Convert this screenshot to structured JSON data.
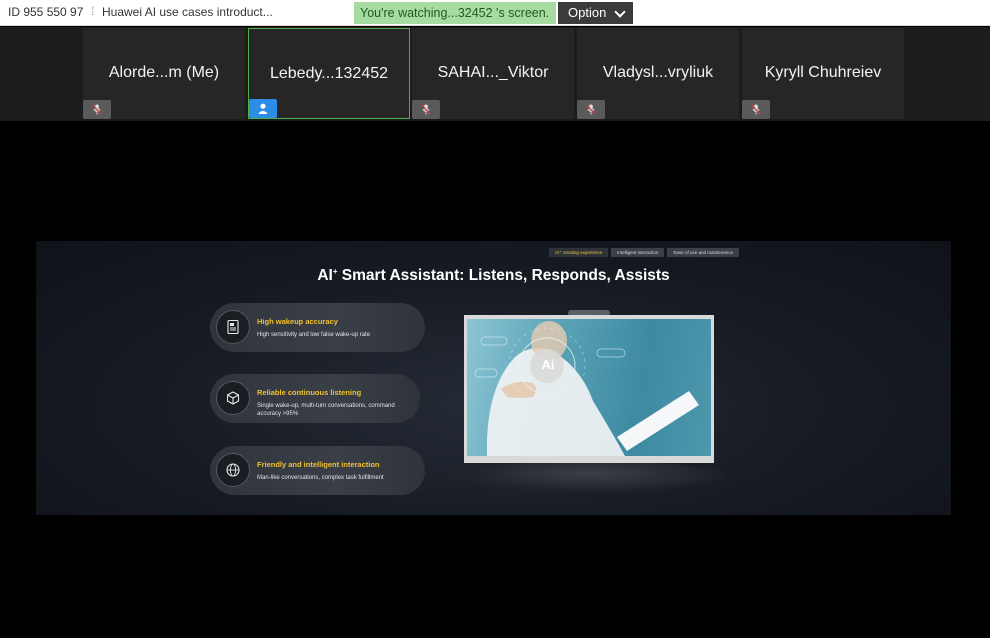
{
  "topbar": {
    "meeting_id": "ID 955 550 97",
    "separator": "⁞",
    "meeting_title": "Huawei AI use cases introduct...",
    "watch_banner": "You're watching...32452 's screen.",
    "option_label": "Option"
  },
  "participants": [
    {
      "name": "Alorde...m (Me)",
      "icon": "mic-muted-icon"
    },
    {
      "name": "Lebedy...132452",
      "icon": "user-icon"
    },
    {
      "name": "SAHAI..._Viktor",
      "icon": "mic-muted-icon"
    },
    {
      "name": "Vladysl...vryliuk",
      "icon": "mic-muted-icon"
    },
    {
      "name": "Kyryll Chuhreiev",
      "icon": "mic-muted-icon"
    }
  ],
  "slide": {
    "tabs": [
      "AI⁺ creating experience",
      "Intelligent interaction",
      "Ease of use and maintenance"
    ],
    "title_prefix": "AI",
    "title_sup": "+",
    "title_rest": " Smart Assistant: Listens, Responds, Assists",
    "features": [
      {
        "icon": "tablet-icon",
        "head": "High wakeup accuracy",
        "desc": "High sensitivity and low false wake-up rate"
      },
      {
        "icon": "cube-icon",
        "head": "Reliable continuous listening",
        "desc": "Single wake-up, multi-turn conversations, command accuracy >95%"
      },
      {
        "icon": "globe-icon",
        "head": "Friendly and intelligent interaction",
        "desc": "Man-like conversations, complex task fulfillment"
      }
    ],
    "screen_badge": "Ai"
  },
  "colors": {
    "active_tile_border": "#4caf50",
    "banner_bg": "#a6dca2",
    "feature_heading": "#f2c230"
  }
}
